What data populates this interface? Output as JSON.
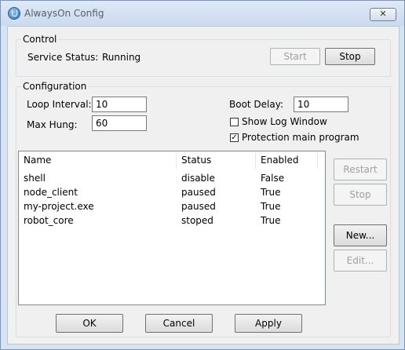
{
  "window": {
    "title": "AlwaysOn Config",
    "close_glyph": "✕"
  },
  "control": {
    "legend": "Control",
    "status_label": "Service Status:",
    "status_value": "Running",
    "start_label": "Start",
    "stop_label": "Stop"
  },
  "configuration": {
    "legend": "Configuration",
    "loop_interval_label": "Loop Interval:",
    "loop_interval_value": "10",
    "max_hung_label": "Max Hung:",
    "max_hung_value": "60",
    "boot_delay_label": "Boot Delay:",
    "boot_delay_value": "10",
    "show_log_label": "Show Log Window",
    "show_log_checked": false,
    "protection_label": "Protection main program",
    "protection_checked": true
  },
  "process_list": {
    "headers": [
      "Name",
      "Status",
      "Enabled"
    ],
    "rows": [
      {
        "name": "shell",
        "status": "disable",
        "enabled": "False"
      },
      {
        "name": "node_client",
        "status": "paused",
        "enabled": "True"
      },
      {
        "name": "my-project.exe",
        "status": "paused",
        "enabled": "True"
      },
      {
        "name": "robot_core",
        "status": "stoped",
        "enabled": "True"
      }
    ]
  },
  "side_buttons": {
    "restart": "Restart",
    "stop": "Stop",
    "new": "New...",
    "edit": "Edit..."
  },
  "footer": {
    "ok": "OK",
    "cancel": "Cancel",
    "apply": "Apply"
  }
}
